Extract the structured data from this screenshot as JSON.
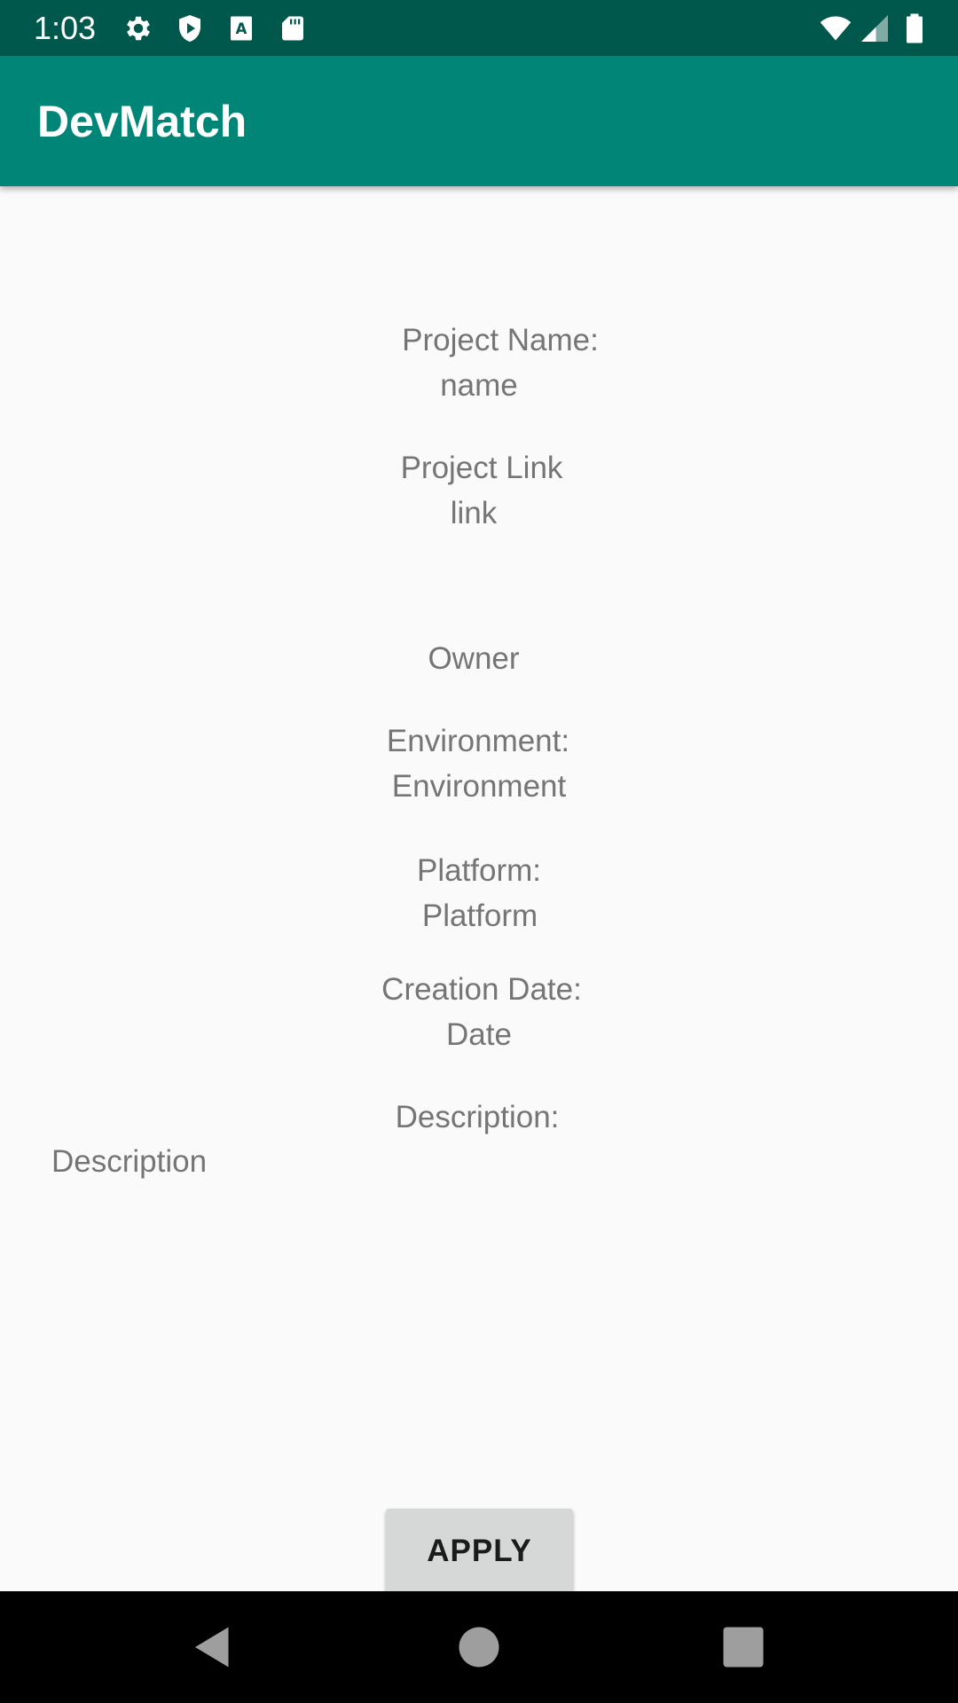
{
  "status_bar": {
    "time": "1:03",
    "icons": [
      "gear-icon",
      "shield-play-icon",
      "a-sim-icon",
      "sd-card-icon",
      "wifi-icon",
      "cellular-signal-icon",
      "battery-icon"
    ]
  },
  "app_bar": {
    "title": "DevMatch",
    "color": "#008577",
    "status_color": "#00574b"
  },
  "project": {
    "name_label": "Project Name:",
    "name_value": "name",
    "link_label": "Project Link",
    "link_value": "link",
    "owner_label": "Owner",
    "environment_label": "Environment:",
    "environment_value": "Environment",
    "platform_label": "Platform:",
    "platform_value": "Platform",
    "date_label": "Creation Date:",
    "date_value": "Date",
    "description_label": "Description:",
    "description_value": "Description"
  },
  "actions": {
    "apply_label": "APPLY"
  },
  "nav_bar": {
    "icons": [
      "back-icon",
      "home-icon",
      "recents-icon"
    ]
  }
}
